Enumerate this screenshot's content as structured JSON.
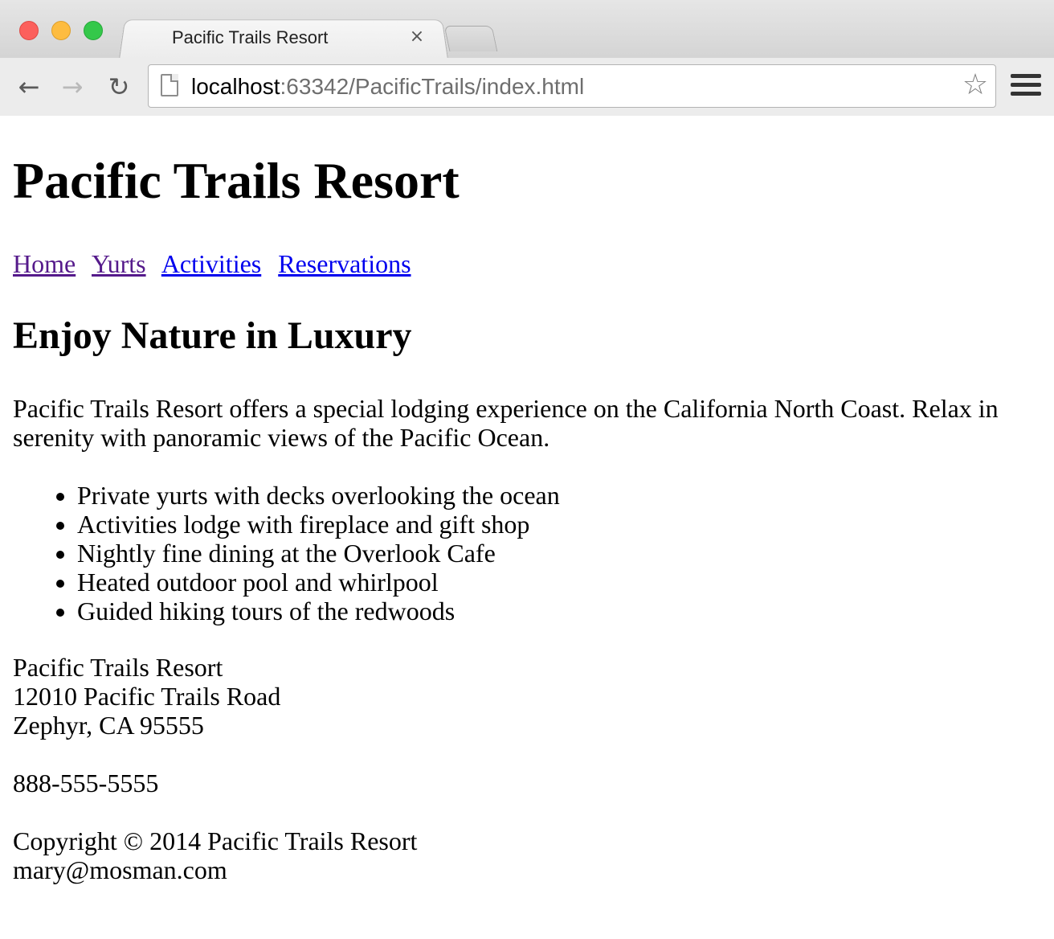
{
  "browser": {
    "tab_title": "Pacific Trails Resort",
    "tab_close": "×",
    "url_host": "localhost",
    "url_rest": ":63342/PacificTrails/index.html",
    "back_icon": "back-arrow-icon",
    "forward_icon": "forward-arrow-icon",
    "reload_icon": "reload-icon",
    "bookmark_icon": "star-icon",
    "menu_icon": "hamburger-menu-icon"
  },
  "page": {
    "title": "Pacific Trails Resort",
    "nav": [
      {
        "label": "Home",
        "state": "visited"
      },
      {
        "label": "Yurts",
        "state": "visited"
      },
      {
        "label": "Activities",
        "state": "unvisited"
      },
      {
        "label": "Reservations",
        "state": "unvisited"
      }
    ],
    "heading": "Enjoy Nature in Luxury",
    "intro": "Pacific Trails Resort offers a special lodging experience on the California North Coast. Relax in serenity with panoramic views of the Pacific Ocean.",
    "features": [
      "Private yurts with decks overlooking the ocean",
      "Activities lodge with fireplace and gift shop",
      "Nightly fine dining at the Overlook Cafe",
      "Heated outdoor pool and whirlpool",
      "Guided hiking tours of the redwoods"
    ],
    "address": {
      "name": "Pacific Trails Resort",
      "street": "12010 Pacific Trails Road",
      "city": "Zephyr, CA 95555"
    },
    "phone": "888-555-5555",
    "footer": {
      "copyright": "Copyright © 2014 Pacific Trails Resort",
      "email": "mary@mosman.com"
    }
  },
  "colors": {
    "visited_link": "#551a8b",
    "unvisited_link": "#0000ee",
    "traffic_red": "#fc605c",
    "traffic_yellow": "#fdbc40",
    "traffic_green": "#34c84a"
  }
}
